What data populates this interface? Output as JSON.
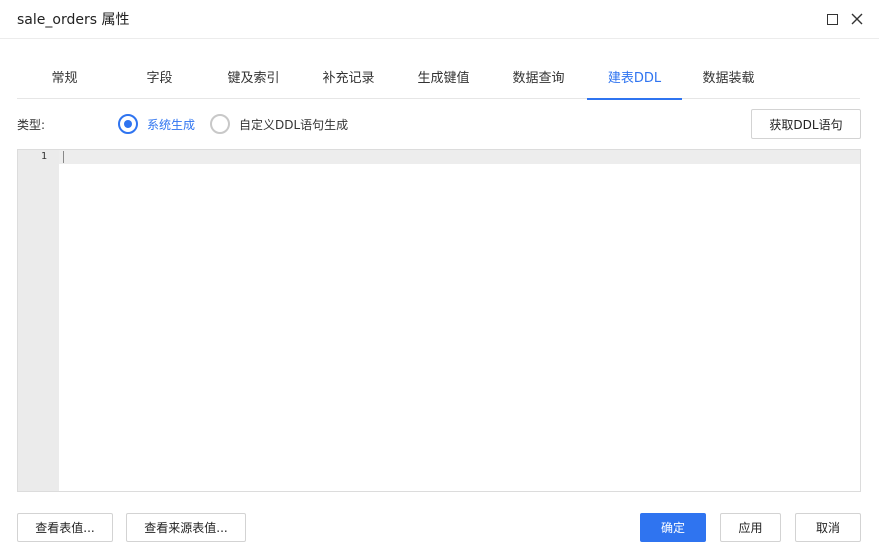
{
  "window": {
    "title": "sale_orders 属性"
  },
  "tabs": [
    {
      "label": "常规"
    },
    {
      "label": "字段"
    },
    {
      "label": "键及索引"
    },
    {
      "label": "补充记录"
    },
    {
      "label": "生成键值"
    },
    {
      "label": "数据查询"
    },
    {
      "label": "建表DDL"
    },
    {
      "label": "数据装载"
    }
  ],
  "active_tab": "建表DDL",
  "type_row": {
    "label": "类型:",
    "options": [
      {
        "label": "系统生成",
        "checked": true
      },
      {
        "label": "自定义DDL语句生成",
        "checked": false
      }
    ],
    "fetch_button": "获取DDL语句"
  },
  "editor": {
    "line_numbers": [
      "1"
    ],
    "content": ""
  },
  "footer": {
    "view_table_values": "查看表值...",
    "view_source_values": "查看来源表值...",
    "ok": "确定",
    "apply": "应用",
    "cancel": "取消"
  },
  "colors": {
    "accent": "#2f74f0",
    "gutter": "#ebebeb",
    "border": "#d3d3d3"
  }
}
